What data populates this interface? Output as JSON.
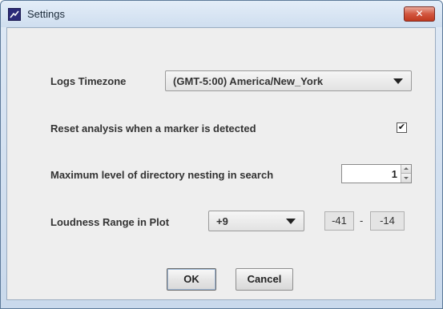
{
  "window": {
    "title": "Settings",
    "close_label": "✕"
  },
  "settings": {
    "timezone": {
      "label": "Logs Timezone",
      "value": "(GMT-5:00) America/New_York"
    },
    "reset_analysis": {
      "label": "Reset analysis when a marker is detected",
      "checked": true,
      "check_glyph": "✔"
    },
    "nesting": {
      "label": "Maximum level of directory nesting in search",
      "value": "1"
    },
    "loudness": {
      "label": "Loudness Range in Plot",
      "value": "+9",
      "range_min": "-41",
      "range_sep": "-",
      "range_max": "-14"
    }
  },
  "buttons": {
    "ok": "OK",
    "cancel": "Cancel"
  },
  "colors": {
    "accent": "#2b2a78",
    "close": "#c0391f",
    "panel": "#eeeeee"
  }
}
